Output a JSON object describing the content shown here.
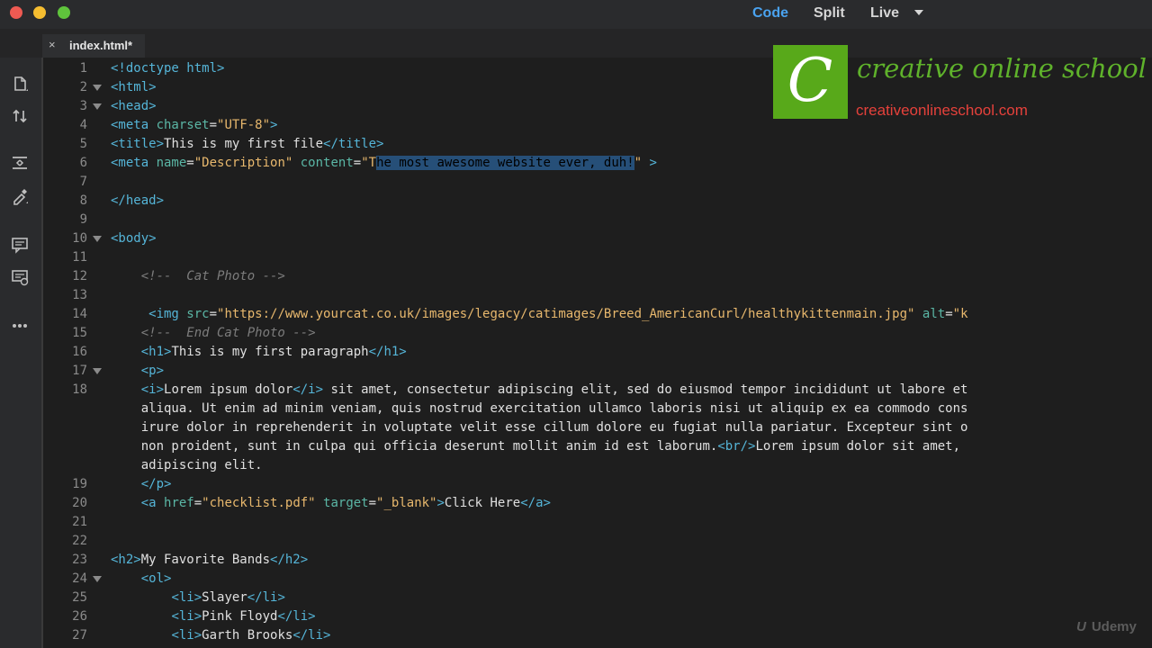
{
  "window": {
    "modes": [
      "Code",
      "Split",
      "Live"
    ],
    "active_mode": "Code"
  },
  "tab": {
    "close_glyph": "×",
    "label": "index.html*"
  },
  "toolbar_icons": [
    "file-icon",
    "sort-arrows-icon",
    "expand-icon",
    "eyedropper-icon",
    "comment-icon",
    "apply-comment-icon",
    "more-icon"
  ],
  "code_lines": [
    {
      "n": "1",
      "fold": false,
      "indent": 0,
      "tokens": [
        [
          "tg",
          "<!doctype html>"
        ]
      ]
    },
    {
      "n": "2",
      "fold": true,
      "indent": 0,
      "tokens": [
        [
          "tg",
          "<html>"
        ]
      ]
    },
    {
      "n": "3",
      "fold": true,
      "indent": 0,
      "tokens": [
        [
          "tg",
          "<head>"
        ]
      ]
    },
    {
      "n": "4",
      "fold": false,
      "indent": 0,
      "tokens": [
        [
          "tg",
          "<meta "
        ],
        [
          "at",
          "charset"
        ],
        [
          "tx",
          "="
        ],
        [
          "av",
          "\"UTF-8\""
        ],
        [
          "tg",
          ">"
        ]
      ]
    },
    {
      "n": "5",
      "fold": false,
      "indent": 0,
      "tokens": [
        [
          "tg",
          "<title>"
        ],
        [
          "tx",
          "This is my first file"
        ],
        [
          "tg",
          "</title>"
        ]
      ]
    },
    {
      "n": "6",
      "fold": false,
      "indent": 0,
      "tokens": [
        [
          "tg",
          "<meta "
        ],
        [
          "at",
          "name"
        ],
        [
          "tx",
          "="
        ],
        [
          "av",
          "\"Description\" "
        ],
        [
          "at",
          "content"
        ],
        [
          "tx",
          "="
        ],
        [
          "av",
          "\"T"
        ],
        [
          "sel",
          "he most awesome website ever, duh!"
        ],
        [
          "av",
          "\""
        ],
        [
          "tg",
          " >"
        ]
      ]
    },
    {
      "n": "7",
      "fold": false,
      "indent": 0,
      "tokens": []
    },
    {
      "n": "8",
      "fold": false,
      "indent": 0,
      "tokens": [
        [
          "tg",
          "</head>"
        ]
      ]
    },
    {
      "n": "9",
      "fold": false,
      "indent": 0,
      "tokens": []
    },
    {
      "n": "10",
      "fold": true,
      "indent": 0,
      "tokens": [
        [
          "tg",
          "<body>"
        ]
      ]
    },
    {
      "n": "11",
      "fold": false,
      "indent": 0,
      "tokens": []
    },
    {
      "n": "12",
      "fold": false,
      "indent": 4,
      "tokens": [
        [
          "cm",
          "<!--  Cat Photo -->"
        ]
      ]
    },
    {
      "n": "13",
      "fold": false,
      "indent": 0,
      "tokens": []
    },
    {
      "n": "14",
      "fold": false,
      "indent": 5,
      "tokens": [
        [
          "tg",
          "<img "
        ],
        [
          "at",
          "src"
        ],
        [
          "tx",
          "="
        ],
        [
          "av",
          "\"https://www.yourcat.co.uk/images/legacy/catimages/Breed_AmericanCurl/healthykittenmain.jpg\" "
        ],
        [
          "at",
          "alt"
        ],
        [
          "tx",
          "="
        ],
        [
          "av",
          "\"k"
        ]
      ]
    },
    {
      "n": "15",
      "fold": false,
      "indent": 4,
      "tokens": [
        [
          "cm",
          "<!--  End Cat Photo -->"
        ]
      ]
    },
    {
      "n": "16",
      "fold": false,
      "indent": 4,
      "tokens": [
        [
          "tg",
          "<h1>"
        ],
        [
          "tx",
          "This is my first paragraph"
        ],
        [
          "tg",
          "</h1>"
        ]
      ]
    },
    {
      "n": "17",
      "fold": true,
      "indent": 4,
      "tokens": [
        [
          "tg",
          "<p>"
        ]
      ]
    },
    {
      "n": "18",
      "fold": false,
      "indent": 4,
      "tokens": [
        [
          "tg",
          "<i>"
        ],
        [
          "tx",
          "Lorem ipsum dolor"
        ],
        [
          "tg",
          "</i>"
        ],
        [
          "tx",
          " sit amet, consectetur adipiscing elit, sed do eiusmod tempor incididunt ut labore et"
        ]
      ]
    },
    {
      "n": "",
      "fold": false,
      "indent": 4,
      "tokens": [
        [
          "tx",
          "aliqua. Ut enim ad minim veniam, quis nostrud exercitation ullamco laboris nisi ut aliquip ex ea commodo cons"
        ]
      ]
    },
    {
      "n": "",
      "fold": false,
      "indent": 4,
      "tokens": [
        [
          "tx",
          "irure dolor in reprehenderit in voluptate velit esse cillum dolore eu fugiat nulla pariatur. Excepteur sint o"
        ]
      ]
    },
    {
      "n": "",
      "fold": false,
      "indent": 4,
      "tokens": [
        [
          "tx",
          "non proident, sunt in culpa qui officia deserunt mollit anim id est laborum."
        ],
        [
          "tg",
          "<br/>"
        ],
        [
          "tx",
          "Lorem ipsum dolor sit amet,"
        ]
      ]
    },
    {
      "n": "",
      "fold": false,
      "indent": 4,
      "tokens": [
        [
          "tx",
          "adipiscing elit."
        ]
      ]
    },
    {
      "n": "19",
      "fold": false,
      "indent": 4,
      "tokens": [
        [
          "tg",
          "</p>"
        ]
      ]
    },
    {
      "n": "20",
      "fold": false,
      "indent": 4,
      "tokens": [
        [
          "tg",
          "<a "
        ],
        [
          "at",
          "href"
        ],
        [
          "tx",
          "="
        ],
        [
          "av",
          "\"checklist.pdf\" "
        ],
        [
          "at",
          "target"
        ],
        [
          "tx",
          "="
        ],
        [
          "av",
          "\"_blank\""
        ],
        [
          "tg",
          ">"
        ],
        [
          "tx",
          "Click Here"
        ],
        [
          "tg",
          "</a>"
        ]
      ]
    },
    {
      "n": "21",
      "fold": false,
      "indent": 0,
      "tokens": []
    },
    {
      "n": "22",
      "fold": false,
      "indent": 0,
      "tokens": []
    },
    {
      "n": "23",
      "fold": false,
      "indent": 0,
      "tokens": [
        [
          "tg",
          "<h2>"
        ],
        [
          "tx",
          "My Favorite Bands"
        ],
        [
          "tg",
          "</h2>"
        ]
      ]
    },
    {
      "n": "24",
      "fold": true,
      "indent": 4,
      "tokens": [
        [
          "tg",
          "<ol>"
        ]
      ]
    },
    {
      "n": "25",
      "fold": false,
      "indent": 8,
      "tokens": [
        [
          "tg",
          "<li>"
        ],
        [
          "tx",
          "Slayer"
        ],
        [
          "tg",
          "</li>"
        ]
      ]
    },
    {
      "n": "26",
      "fold": false,
      "indent": 8,
      "tokens": [
        [
          "tg",
          "<li>"
        ],
        [
          "tx",
          "Pink Floyd"
        ],
        [
          "tg",
          "</li>"
        ]
      ]
    },
    {
      "n": "27",
      "fold": false,
      "indent": 8,
      "tokens": [
        [
          "tg",
          "<li>"
        ],
        [
          "tx",
          "Garth Brooks"
        ],
        [
          "tg",
          "</li>"
        ]
      ]
    }
  ],
  "overlay_logo": {
    "letter": "C",
    "name": "creative online school",
    "url": "creativeonlineschool.com"
  },
  "watermark": {
    "mark": "U",
    "text": "Udemy"
  }
}
